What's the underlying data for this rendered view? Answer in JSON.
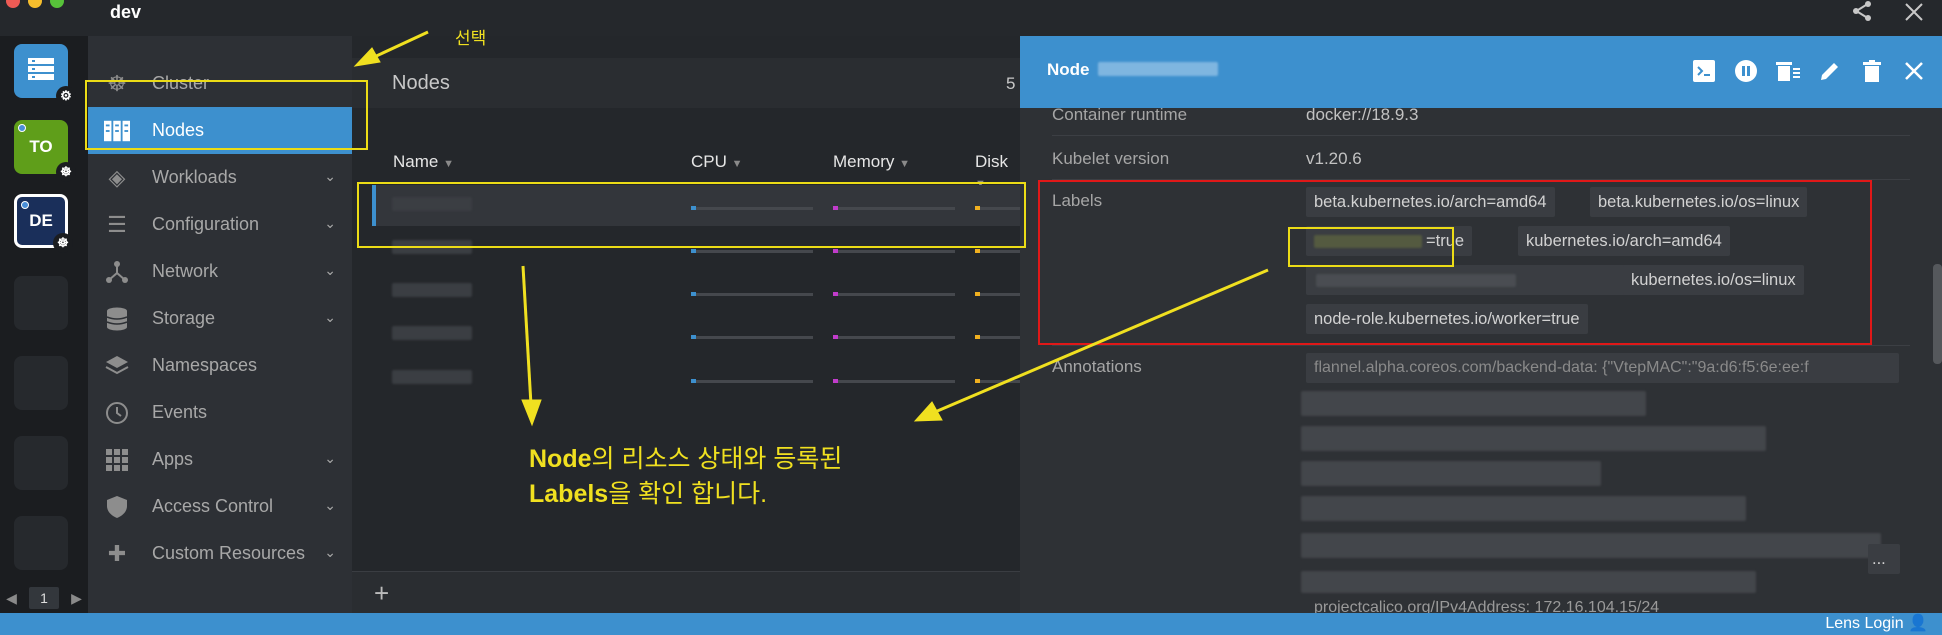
{
  "app": {
    "title": "dev"
  },
  "hotbar": {
    "items": [
      {
        "label": "TO",
        "color": "#5f9e1a"
      },
      {
        "label": "DE",
        "color": "#1a2f5a"
      }
    ],
    "page": "1"
  },
  "sidebar": {
    "items": [
      {
        "label": "Cluster",
        "icon": "helm-wheel-icon",
        "expandable": false
      },
      {
        "label": "Nodes",
        "icon": "nodes-icon",
        "expandable": false,
        "active": true
      },
      {
        "label": "Workloads",
        "icon": "cubes-icon",
        "expandable": true
      },
      {
        "label": "Configuration",
        "icon": "list-icon",
        "expandable": true
      },
      {
        "label": "Network",
        "icon": "network-icon",
        "expandable": true
      },
      {
        "label": "Storage",
        "icon": "database-icon",
        "expandable": true
      },
      {
        "label": "Namespaces",
        "icon": "layers-icon",
        "expandable": false
      },
      {
        "label": "Events",
        "icon": "clock-icon",
        "expandable": false
      },
      {
        "label": "Apps",
        "icon": "apps-grid-icon",
        "expandable": true
      },
      {
        "label": "Access Control",
        "icon": "shield-icon",
        "expandable": true
      },
      {
        "label": "Custom Resources",
        "icon": "puzzle-icon",
        "expandable": true
      }
    ]
  },
  "main": {
    "title": "Nodes",
    "count": "5",
    "columns": [
      "Name",
      "CPU",
      "Memory",
      "Disk"
    ],
    "colors": {
      "cpu": "#3d90ce",
      "memory": "#c13ccb",
      "disk": "#f0b020"
    }
  },
  "details": {
    "title": "Node",
    "container_runtime_label": "Container runtime",
    "container_runtime": "docker://18.9.3",
    "kubelet_label": "Kubelet version",
    "kubelet": "v1.20.6",
    "labels_label": "Labels",
    "labels": [
      "beta.kubernetes.io/arch=amd64",
      "beta.kubernetes.io/os=linux",
      "=true",
      "kubernetes.io/arch=amd64",
      "kubernetes.io/os=linux",
      "node-role.kubernetes.io/worker=true"
    ],
    "annotations_label": "Annotations",
    "annotations_first": "flannel.alpha.coreos.com/backend-data: {\"VtepMAC\":\"9a:d6:f5:6e:ee:f",
    "annotations_more": "...",
    "annotations_last": "projectcalico.org/IPv4Address: 172.16.104.15/24"
  },
  "footer": {
    "add": "+"
  },
  "status": {
    "login": "Lens Login"
  },
  "annotations": {
    "select": "선택",
    "note_line1_bold": "Node",
    "note_line1_rest": "의 리소스 상태와 등록된",
    "note_line2_bold": "Labels",
    "note_line2_rest": "을 확인 합니다."
  }
}
